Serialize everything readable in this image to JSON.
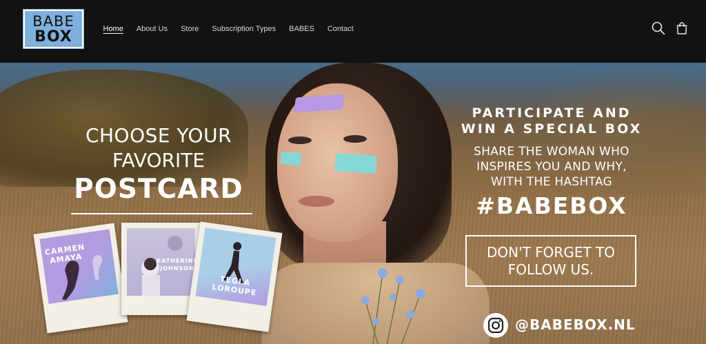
{
  "header": {
    "logo": {
      "line1": "BABE",
      "line2": "BOX"
    },
    "nav": [
      {
        "label": "Home",
        "active": true
      },
      {
        "label": "About Us",
        "active": false
      },
      {
        "label": "Store",
        "active": false
      },
      {
        "label": "Subscription Types",
        "active": false
      },
      {
        "label": "BABES",
        "active": false
      },
      {
        "label": "Contact",
        "active": false
      }
    ],
    "icons": {
      "search": "search-icon",
      "cart": "cart-icon"
    }
  },
  "hero": {
    "left": {
      "line1": "CHOOSE YOUR",
      "line2": "FAVORITE",
      "line3": "POSTCARD"
    },
    "postcards": [
      {
        "name_line1": "CARMEN",
        "name_line2": "AMAYA"
      },
      {
        "name_line1": "KATHERINE",
        "name_line2": "JOHNSON"
      },
      {
        "name_line1": "TEGLA",
        "name_line2": "LOROUPE"
      }
    ],
    "right": {
      "heading_line1": "PARTICIPATE AND",
      "heading_line2": "WIN A SPECIAL BOX",
      "body_line1": "SHARE THE WOMAN WHO",
      "body_line2": "INSPIRES YOU AND WHY,",
      "body_line3": "WITH THE HASHTAG",
      "hashtag": "#BABEBOX",
      "follow_line1": "DON'T FORGET TO",
      "follow_line2": "FOLLOW US.",
      "instagram_handle": "@BABEBOX.NL"
    }
  },
  "colors": {
    "header_bg": "#121212",
    "logo_bg": "#7fb0dc",
    "paint_purple": "#b698e6",
    "paint_teal": "#86d8d8"
  }
}
